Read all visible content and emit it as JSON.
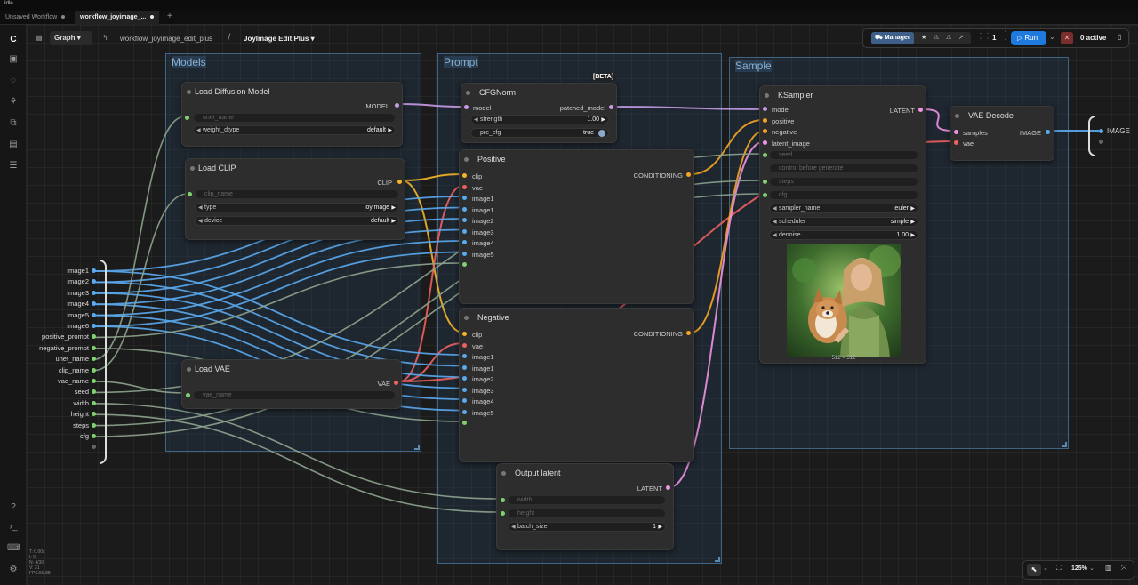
{
  "titlebar": {
    "title": "Idle"
  },
  "tabs": [
    {
      "label": "Unsaved Workflow",
      "active": false
    },
    {
      "label": "workflow_joyimage_...",
      "active": true
    }
  ],
  "toolbar": {
    "graph_label": "Graph",
    "breadcrumb_path": "workflow_joyimage_edit_plus",
    "breadcrumb_sep": "/",
    "breadcrumb_current": "JoyImage Edit Plus",
    "manager_label": "Manager",
    "queue_count": "1",
    "run_label": "Run",
    "active_label": "0 active"
  },
  "zoom": {
    "label": "125%"
  },
  "stats": {
    "lines": [
      "T: 0.00s",
      "I: 0",
      "N: 4/30",
      "V: 31",
      "FPS:59.88"
    ]
  },
  "groups": {
    "models": "Models",
    "prompt": "Prompt",
    "sample": "Sample"
  },
  "nodes": {
    "load_diffusion": {
      "title": "Load Diffusion Model",
      "output": "MODEL",
      "unet_name": "unet_name",
      "weight_dtype_label": "weight_dtype",
      "weight_dtype_value": "default"
    },
    "load_clip": {
      "title": "Load CLIP",
      "output": "CLIP",
      "clip_name": "clip_name",
      "type_label": "type",
      "type_value": "joyimage",
      "device_label": "device",
      "device_value": "default"
    },
    "load_vae": {
      "title": "Load VAE",
      "output": "VAE",
      "vae_name": "vae_name"
    },
    "cfgnorm": {
      "title": "CFGNorm",
      "badge": "[BETA]",
      "input": "model",
      "output": "patched_model",
      "strength_label": "strength",
      "strength_value": "1.00",
      "pre_cfg_label": "pre_cfg",
      "pre_cfg_value": "true"
    },
    "positive": {
      "title": "Positive",
      "output": "CONDITIONING",
      "inputs": [
        "clip",
        "vae",
        "image1",
        "image1",
        "image2",
        "image3",
        "image4",
        "image5"
      ]
    },
    "negative": {
      "title": "Negative",
      "output": "CONDITIONING",
      "inputs": [
        "clip",
        "vae",
        "image1",
        "image1",
        "image2",
        "image3",
        "image4",
        "image5"
      ]
    },
    "ksampler": {
      "title": "KSampler",
      "output": "LATENT",
      "inputs": [
        "model",
        "positive",
        "negative",
        "latent_image"
      ],
      "seed": "seed",
      "control": "control before generate",
      "steps": "steps",
      "cfg": "cfg",
      "sampler_label": "sampler_name",
      "sampler_value": "euler",
      "scheduler_label": "scheduler",
      "scheduler_value": "simple",
      "denoise_label": "denoise",
      "denoise_value": "1.00",
      "preview_size": "512 × 512"
    },
    "vae_decode": {
      "title": "VAE Decode",
      "inputs": [
        "samples",
        "vae"
      ],
      "output": "IMAGE"
    },
    "output_latent": {
      "title": "Output latent",
      "output": "LATENT",
      "width": "width",
      "height": "height",
      "batch_label": "batch_size",
      "batch_value": "1"
    }
  },
  "subgraph_inputs": [
    "image1",
    "image2",
    "image3",
    "image4",
    "image5",
    "image6",
    "positive_prompt",
    "negative_prompt",
    "unet_name",
    "clip_name",
    "vae_name",
    "seed",
    "width",
    "height",
    "steps",
    "cfg"
  ],
  "subgraph_output": "IMAGE",
  "colors": {
    "clip": "#f5b52a",
    "vae": "#f0615f",
    "model": "#c79be8",
    "latent": "#f094e6",
    "image": "#5aaaf0",
    "conditioning": "#f5a623",
    "generic": "#8fa58f",
    "accent": "#1f7ae0"
  }
}
